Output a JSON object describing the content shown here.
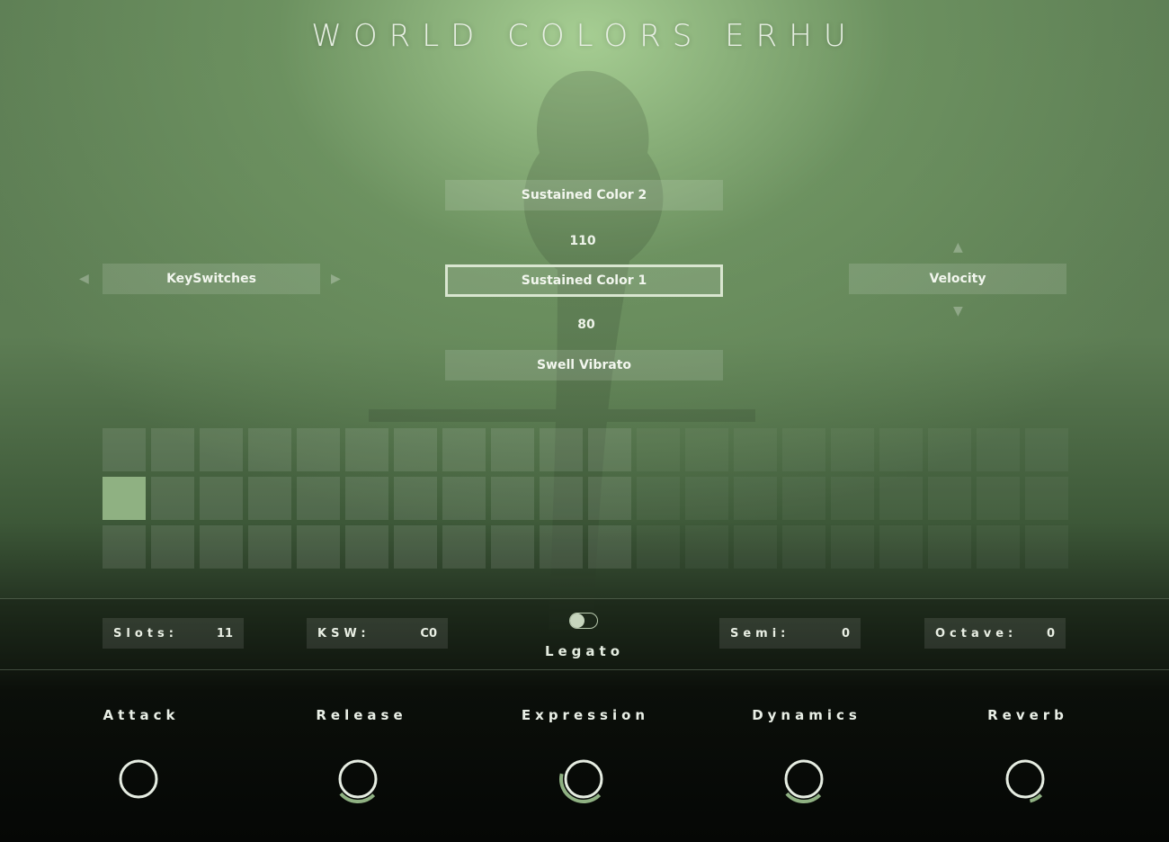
{
  "title": "WORLD COLORS ERHU",
  "articulations": {
    "upper": "Sustained Color 2",
    "upper_value": "110",
    "active": "Sustained Color 1",
    "lower_value": "80",
    "lower": "Swell Vibrato"
  },
  "left_selector": {
    "label": "KeySwitches"
  },
  "right_selector": {
    "label": "Velocity"
  },
  "slots_grid": {
    "rows": 3,
    "columns": 20,
    "active_columns": 11,
    "selected": {
      "row": 1,
      "column": 0
    }
  },
  "controls": {
    "slots_label": "Slots:",
    "slots_value": "11",
    "ksw_label": "KSW:",
    "ksw_value": "C0",
    "legato_label": "Legato",
    "legato_on": false,
    "semi_label": "Semi:",
    "semi_value": "0",
    "octave_label": "Octave:",
    "octave_value": "0"
  },
  "knobs": [
    {
      "label": "Attack",
      "level": 0.0
    },
    {
      "label": "Release",
      "level": 0.35
    },
    {
      "label": "Expression",
      "level": 0.55
    },
    {
      "label": "Dynamics",
      "level": 0.35
    },
    {
      "label": "Reverb",
      "level": 0.12
    }
  ],
  "colors": {
    "accent": "#8fb182",
    "knob_ring": "#e6ede2"
  }
}
